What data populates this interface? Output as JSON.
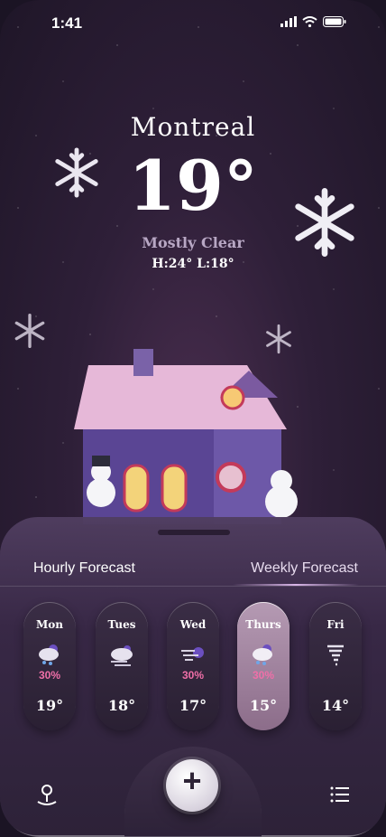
{
  "status_bar": {
    "time": "1:41"
  },
  "weather": {
    "city": "Montreal",
    "temperature": "19°",
    "condition": "Mostly Clear",
    "high_low": "H:24°  L:18°"
  },
  "forecast_tabs": {
    "hourly": "Hourly Forecast",
    "weekly": "Weekly Forecast"
  },
  "days": [
    {
      "day": "Mon",
      "chance": "30%",
      "temp": "19°",
      "icon": "cloud-snow-moon-icon"
    },
    {
      "day": "Tues",
      "chance": "",
      "temp": "18°",
      "icon": "cloud-wind-icon"
    },
    {
      "day": "Wed",
      "chance": "30%",
      "temp": "17°",
      "icon": "wind-moon-icon"
    },
    {
      "day": "Thurs",
      "chance": "30%",
      "temp": "15°",
      "icon": "cloud-snow-moon-icon"
    },
    {
      "day": "Fri",
      "chance": "",
      "temp": "14°",
      "icon": "tornado-icon"
    }
  ],
  "active_day": "Thurs",
  "colors": {
    "accent_pink": "#ef6fa8",
    "background": "#2e1f38"
  }
}
